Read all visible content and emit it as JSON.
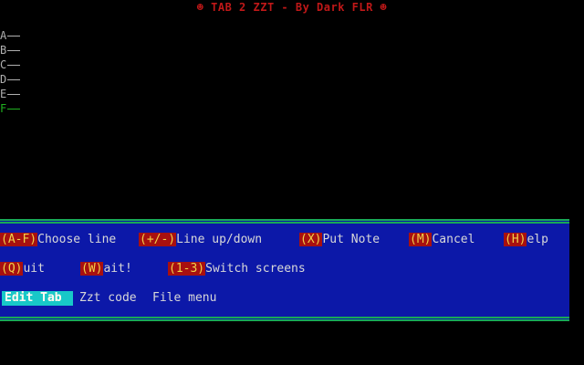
{
  "colors": {
    "background": "#000000",
    "title": "#c01818",
    "panel": "#0c18a8",
    "panel_border": "#18a858",
    "key_bg": "#a81010",
    "key_fg": "#f0d048",
    "active_line": "#20b020",
    "selected_menu_bg": "#18c8c8"
  },
  "title": "☻ TAB 2 ZZT - By Dark FLR ☻",
  "tab_lines": [
    {
      "letter": "A",
      "active": false
    },
    {
      "letter": "B",
      "active": false
    },
    {
      "letter": "C",
      "active": false
    },
    {
      "letter": "D",
      "active": false
    },
    {
      "letter": "E",
      "active": false
    },
    {
      "letter": "F",
      "active": true
    }
  ],
  "commands_row1": [
    {
      "key": "(A-F)",
      "label": "Choose line"
    },
    {
      "key": "(+/-)",
      "label": "Line up/down"
    },
    {
      "key": "(X)",
      "label": "Put Note"
    },
    {
      "key": "(M)",
      "label": "Cancel"
    },
    {
      "key": "(H)",
      "label": "elp"
    }
  ],
  "commands_row2": [
    {
      "key": "(Q)",
      "label": "uit"
    },
    {
      "key": "(W)",
      "label": "ait!"
    },
    {
      "key": "(1-3)",
      "label": "Switch screens"
    }
  ],
  "menu": [
    {
      "label": "Edit Tab",
      "selected": true
    },
    {
      "label": "Zzt code",
      "selected": false
    },
    {
      "label": "File menu",
      "selected": false
    }
  ]
}
